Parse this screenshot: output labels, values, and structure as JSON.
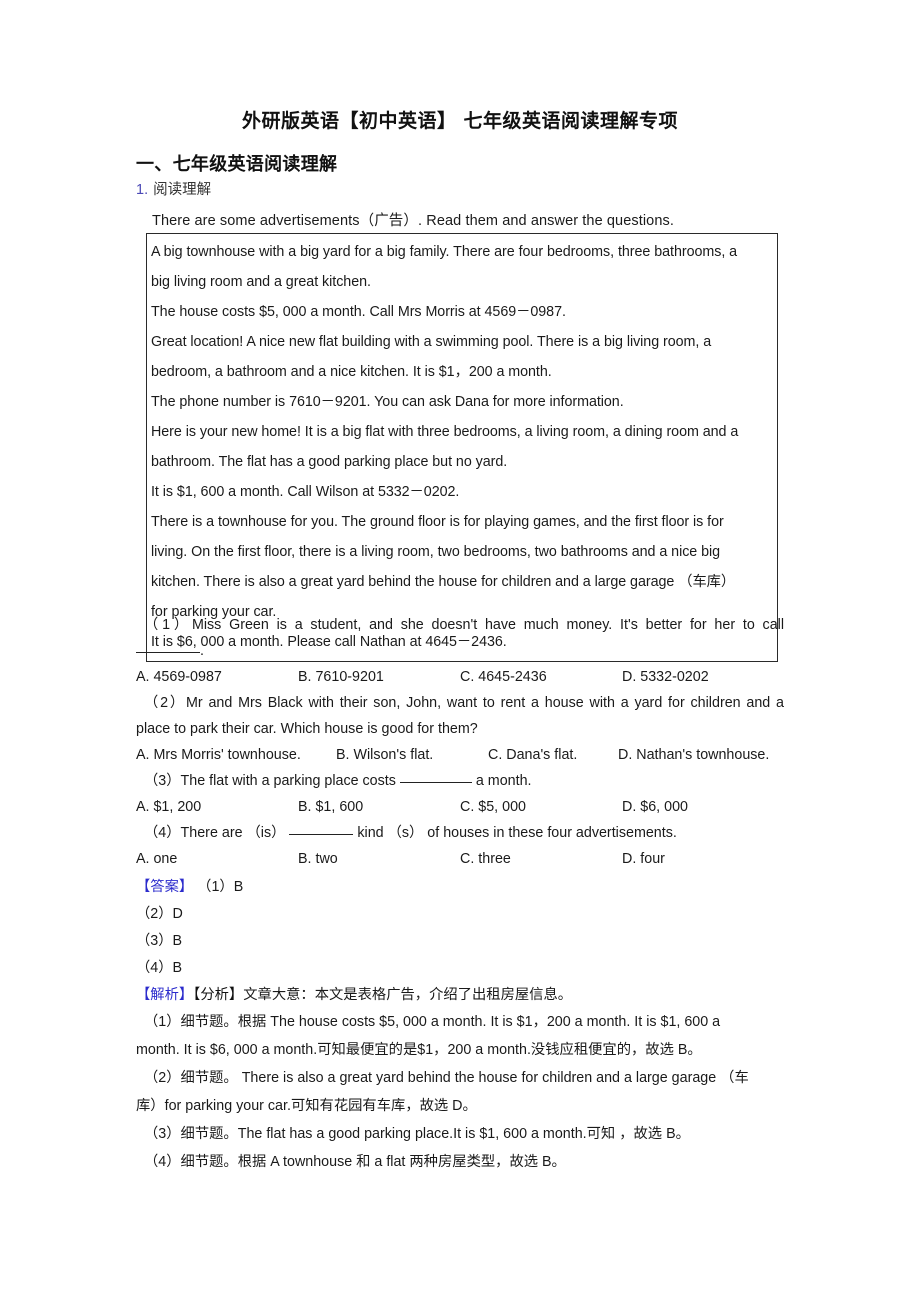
{
  "document": {
    "title": "外研版英语【初中英语】 七年级英语阅读理解专项",
    "section_heading": "一、七年级英语阅读理解",
    "item_number": "1.",
    "item_label": "阅读理解",
    "intro": "There are some advertisements（广告）. Read them and answer the questions."
  },
  "ad_box": {
    "lines": [
      "A big townhouse with a big yard for a   big family. There are four bedrooms, three bathrooms, a",
      "big living room and a   great kitchen.",
      "The house costs $5, 000 a month. Call   Mrs Morris at 4569－0987.",
      "Great location! A nice new flat    building with a swimming pool. There is a big living room, a",
      "bedroom, a   bathroom and a nice kitchen. It is $1，200 a month.",
      "The phone number is 7610－9201. You can ask   Dana for more information.",
      "Here is your new home! It is a big   flat with three bedrooms, a living room, a dining room and a",
      "bathroom. The   flat has a good parking place but no yard.",
      "It is $1, 600 a month. Call Wilson at   5332－0202.",
      "There is a townhouse for you. The   ground floor is for playing games, and the first floor is for",
      "living. On the   first floor, there is a living room, two bedrooms, two bathrooms and a nice   big",
      "kitchen. There is also a great yard behind the house for children and a   large garage （车库）",
      "for parking your car.",
      "It is $6, 000 a month. Please call   Nathan at 4645－2436."
    ]
  },
  "questions": [
    {
      "id": "q1",
      "stem_prefix": "（1）Miss Green is a student, and she doesn't have much money. It's better for her to call",
      "stem_suffix": ".",
      "options": [
        "A. 4569-0987",
        "B. 7610-9201",
        "C. 4645-2436",
        "D. 5332-0202"
      ]
    },
    {
      "id": "q2",
      "stem_line1": "（2）Mr and Mrs Black with their son, John, want to rent a house with a yard for children and a",
      "stem_line2": "place to park their car. Which house is good for them?",
      "options": [
        "A. Mrs Morris' townhouse.",
        "B. Wilson's flat.",
        "C. Dana's flat.",
        "D. Nathan's townhouse."
      ]
    },
    {
      "id": "q3",
      "stem_prefix": "（3）The flat with a parking place costs",
      "stem_suffix": "a month.",
      "options": [
        "A. $1, 200",
        "B. $1, 600",
        "C. $5, 000",
        "D. $6, 000"
      ]
    },
    {
      "id": "q4",
      "stem_prefix": "（4）There are （is）",
      "stem_suffix": "kind （s） of houses in these four advertisements.",
      "options": [
        "A. one",
        "B. two",
        "C. three",
        "D. four"
      ]
    }
  ],
  "answers": {
    "tag": "【答案】",
    "lines": [
      "（1）B",
      "（2）D",
      "（3）B",
      "（4）B"
    ]
  },
  "analysis": {
    "tag_explain": "【解析】",
    "tag_analyze": "【分析】",
    "summary": "文章大意：本文是表格广告，介绍了出租房屋信息。",
    "items": [
      {
        "line1": "（1）细节题。根据 The house costs $5, 000 a month. It is $1，200 a month. It is $1, 600 a",
        "line2": "month. It is $6, 000 a month.可知最便宜的是$1，200 a month.没钱应租便宜的，故选 B。"
      },
      {
        "line1": "（2）细节题。 There is also a great yard behind the house for children and a large garage （车",
        "line2": "库）for parking your car.可知有花园有车库，故选 D。"
      },
      {
        "line1": "（3）细节题。The flat has a good parking place.It is $1, 600 a month.可知 ，故选 B。",
        "line2": ""
      },
      {
        "line1": "（4）细节题。根据 A townhouse 和 a flat 两种房屋类型，故选 B。",
        "line2": ""
      }
    ]
  },
  "colors": {
    "accent_blue": "#2b2bcc",
    "item_number_purple": "#4b49b6",
    "text": "#1a1a1a",
    "box_border": "#2a2a2a"
  }
}
